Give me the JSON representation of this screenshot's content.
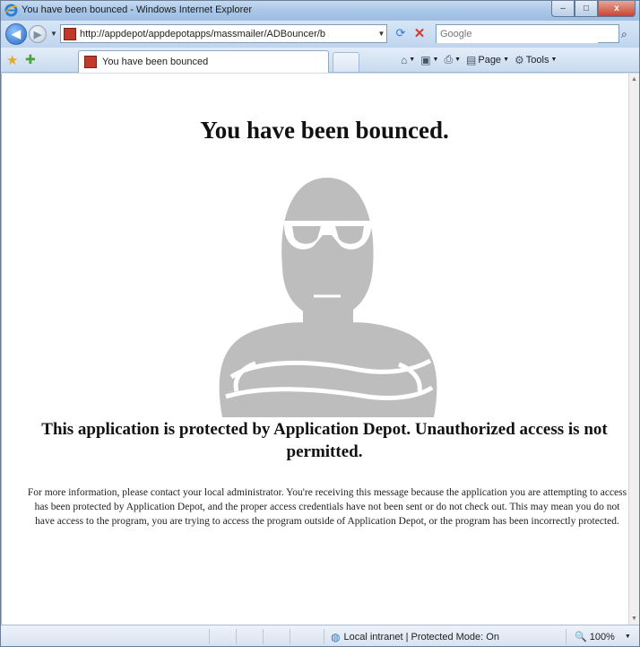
{
  "window": {
    "title": "You have been bounced - Windows Internet Explorer",
    "minimize": "–",
    "maximize": "□",
    "close": "x"
  },
  "nav": {
    "url": "http://appdepot/appdepotapps/massmailer/ADBouncer/b",
    "search_placeholder": "Google"
  },
  "tab": {
    "label": "You have been bounced"
  },
  "commands": [
    {
      "label": "",
      "icon": "home-icon"
    },
    {
      "label": "",
      "icon": "feeds-icon"
    },
    {
      "label": "",
      "icon": "print-icon"
    },
    {
      "label": "Page",
      "icon": "page-icon"
    },
    {
      "label": "Tools",
      "icon": "tools-icon"
    }
  ],
  "page": {
    "heading": "You have been bounced.",
    "subheading": "This application is protected by Application Depot. Unauthorized access is not permitted.",
    "message": "For more information, please contact your local administrator. You're receiving this message because the application you are attempting to access has been protected by Application Depot, and the proper access credentials have not been sent or do not check out. This may mean you do not have access to the program, you are trying to access the program outside of Application Depot, or the program has been incorrectly protected.",
    "image_fill": "#bdbdbd"
  },
  "status": {
    "zone": "Local intranet | Protected Mode: On",
    "zoom": "100%"
  }
}
